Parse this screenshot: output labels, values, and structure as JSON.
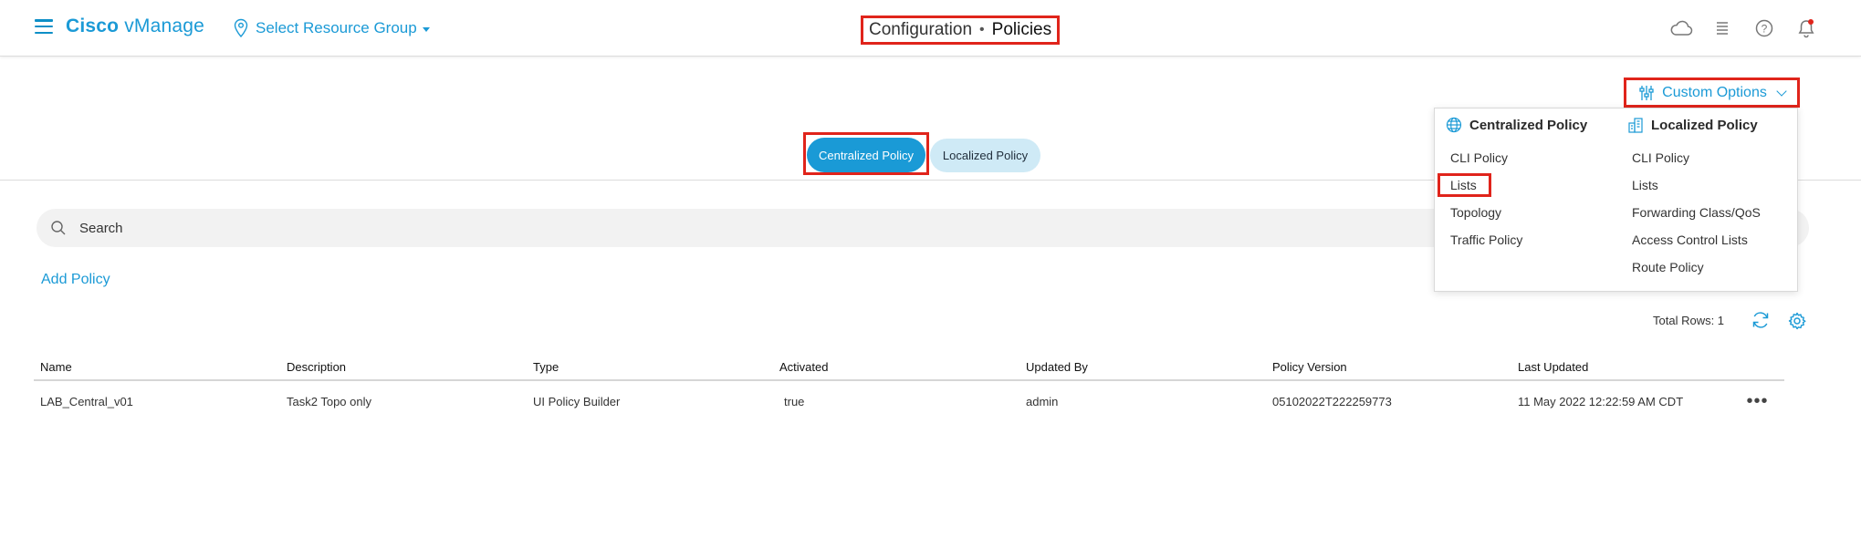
{
  "header": {
    "brand_bold": "Cisco",
    "brand_rest": " vManage",
    "resource_group": "Select Resource Group",
    "breadcrumb_parent": "Configuration",
    "breadcrumb_sep": "•",
    "breadcrumb_current": "Policies",
    "icons": [
      "cloud-icon",
      "task-list-icon",
      "help-icon",
      "notification-bell-icon"
    ],
    "accent_color": "#1b9ad6",
    "alert_dot_color": "#e0241b"
  },
  "custom_options": {
    "label": "Custom Options",
    "icon": "sliders-icon"
  },
  "dropdown": {
    "centralized": {
      "title": "Centralized Policy",
      "icon": "globe-icon",
      "items": [
        "CLI Policy",
        "Lists",
        "Topology",
        "Traffic Policy"
      ]
    },
    "localized": {
      "title": "Localized Policy",
      "icon": "building-icon",
      "items": [
        "CLI Policy",
        "Lists",
        "Forwarding Class/QoS",
        "Access Control Lists",
        "Route Policy"
      ]
    }
  },
  "tabs": {
    "centralized": "Centralized Policy",
    "localized": "Localized Policy",
    "active": "Centralized Policy"
  },
  "search": {
    "placeholder": "Search"
  },
  "actions": {
    "add_policy": "Add Policy"
  },
  "table": {
    "total_rows": "Total Rows: 1",
    "columns": [
      "Name",
      "Description",
      "Type",
      "Activated",
      "Updated By",
      "Policy Version",
      "Last Updated"
    ],
    "rows": [
      [
        "LAB_Central_v01",
        "Task2 Topo only",
        "UI Policy Builder",
        "true",
        "admin",
        "05102022T222259773",
        "11 May 2022 12:22:59 AM CDT"
      ]
    ],
    "row_menu": "•••"
  }
}
